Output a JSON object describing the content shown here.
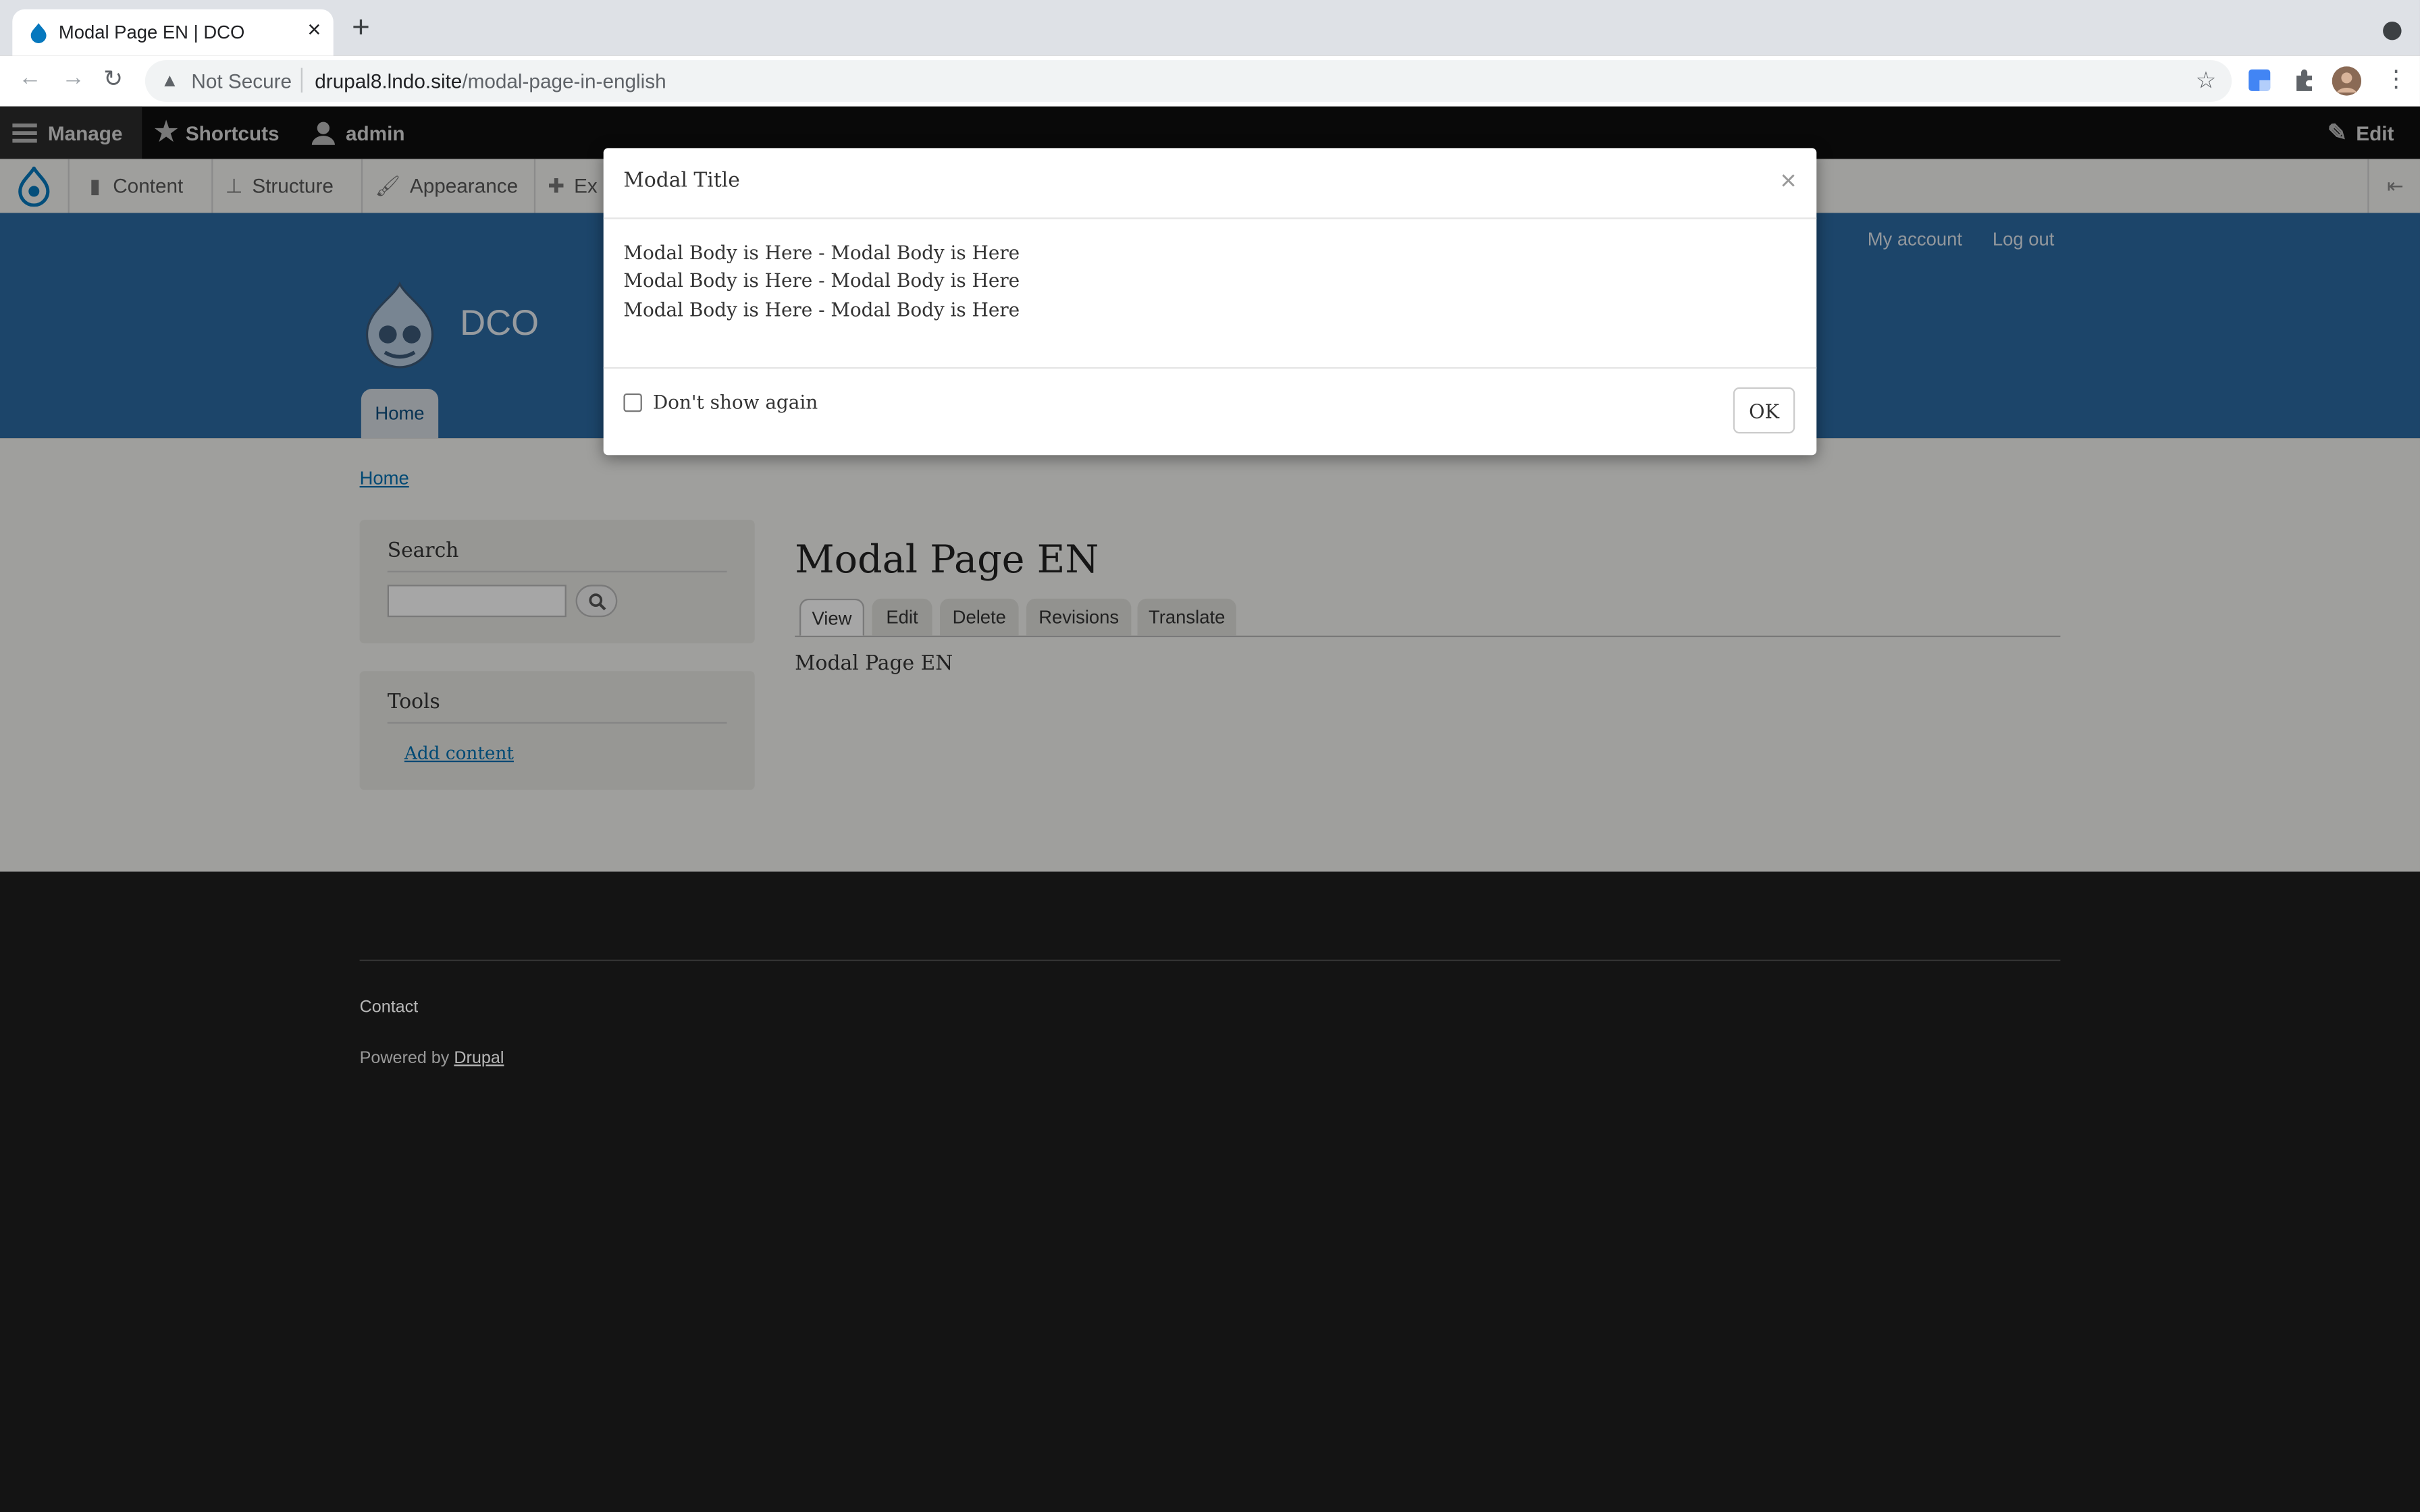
{
  "browser": {
    "tab_title": "Modal Page EN | DCO",
    "tab_close": "×",
    "new_tab": "+",
    "security_label": "Not Secure",
    "url_host": "drupal8.lndo.site",
    "url_path": "/modal-page-in-english"
  },
  "toolbar": {
    "manage": "Manage",
    "shortcuts": "Shortcuts",
    "user": "admin",
    "edit": "Edit",
    "content": "Content",
    "structure": "Structure",
    "appearance": "Appearance",
    "extend_partial": "Ex"
  },
  "site": {
    "name": "DCO",
    "account_link": "My account",
    "logout_link": "Log out",
    "home_tab": "Home",
    "breadcrumb_home": "Home"
  },
  "sidebar": {
    "search_title": "Search",
    "tools_title": "Tools",
    "add_content": "Add content"
  },
  "main": {
    "page_title": "Modal Page EN",
    "tabs": [
      "View",
      "Edit",
      "Delete",
      "Revisions",
      "Translate"
    ],
    "body_text": "Modal Page EN"
  },
  "footer": {
    "contact": "Contact",
    "powered_by": "Powered by",
    "drupal_link": "Drupal"
  },
  "modal": {
    "title": "Modal Title",
    "close": "×",
    "body_lines": [
      "Modal Body is Here - Modal Body is Here",
      "Modal Body is Here - Modal Body is Here",
      "Modal Body is Here - Modal Body is Here"
    ],
    "checkbox_label": "Don't show again",
    "ok_label": "OK"
  },
  "colors": {
    "header_blue": "#2b6aa4",
    "drupal_blue": "#0678be",
    "footer_dark": "#141414"
  }
}
